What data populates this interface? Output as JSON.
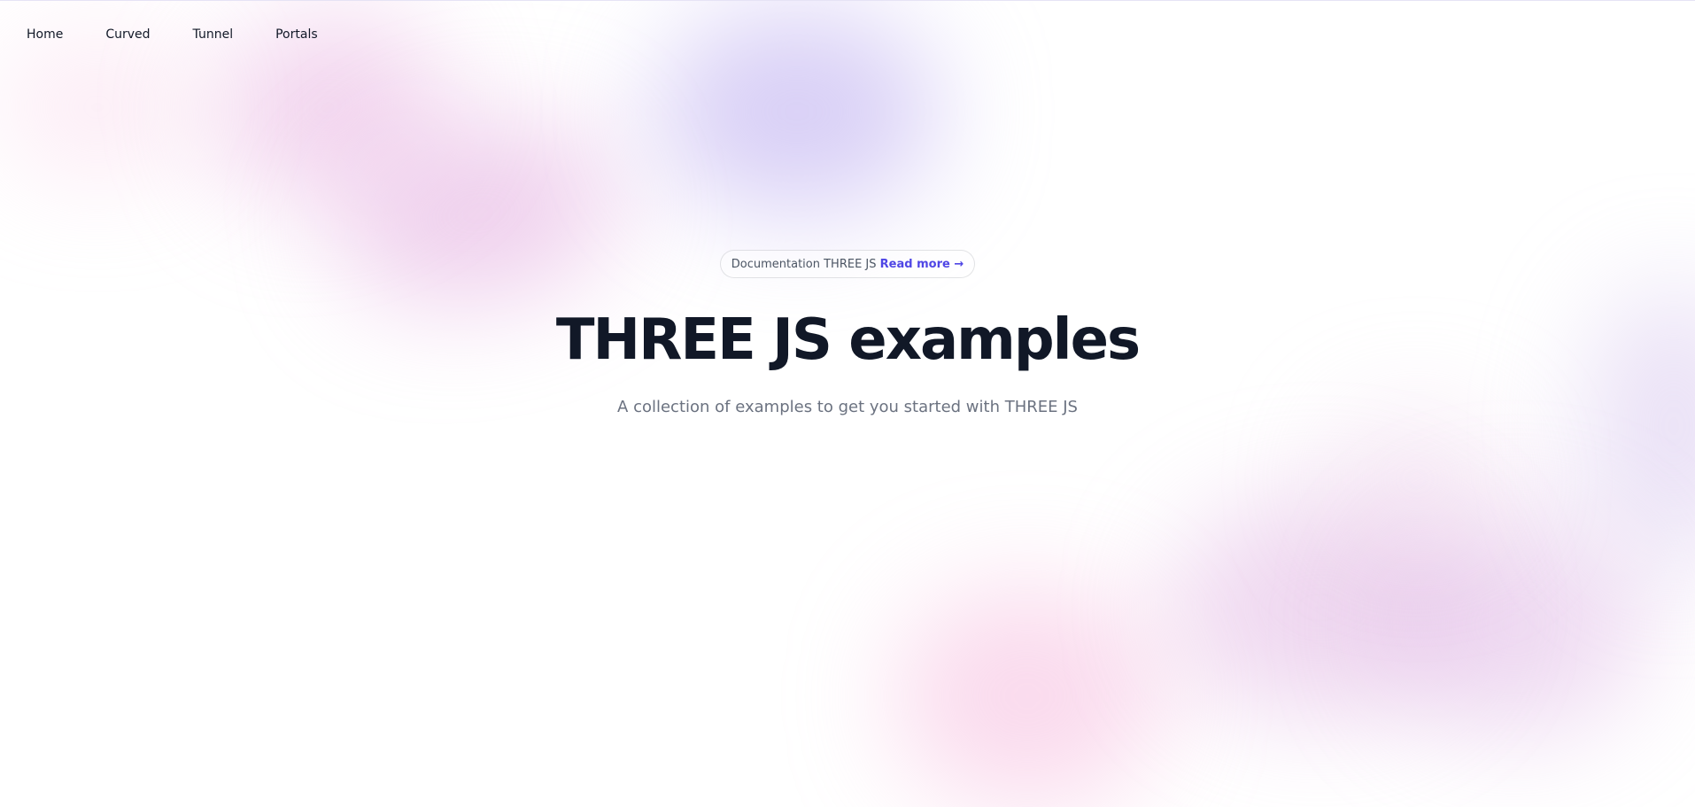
{
  "nav": {
    "links": [
      {
        "label": "Home"
      },
      {
        "label": "Curved"
      },
      {
        "label": "Tunnel"
      },
      {
        "label": "Portals"
      }
    ]
  },
  "hero": {
    "badge_text": "Documentation THREE JS ",
    "badge_link": "Read more →",
    "title": "THREE JS examples",
    "subtitle": "A collection of examples to get you started with THREE JS"
  },
  "colors": {
    "text_primary": "#111827",
    "text_muted": "#6b7280",
    "accent": "#4f46e5",
    "blob_pink": "#e6b0e0",
    "blob_lavender": "#c8baf2"
  }
}
